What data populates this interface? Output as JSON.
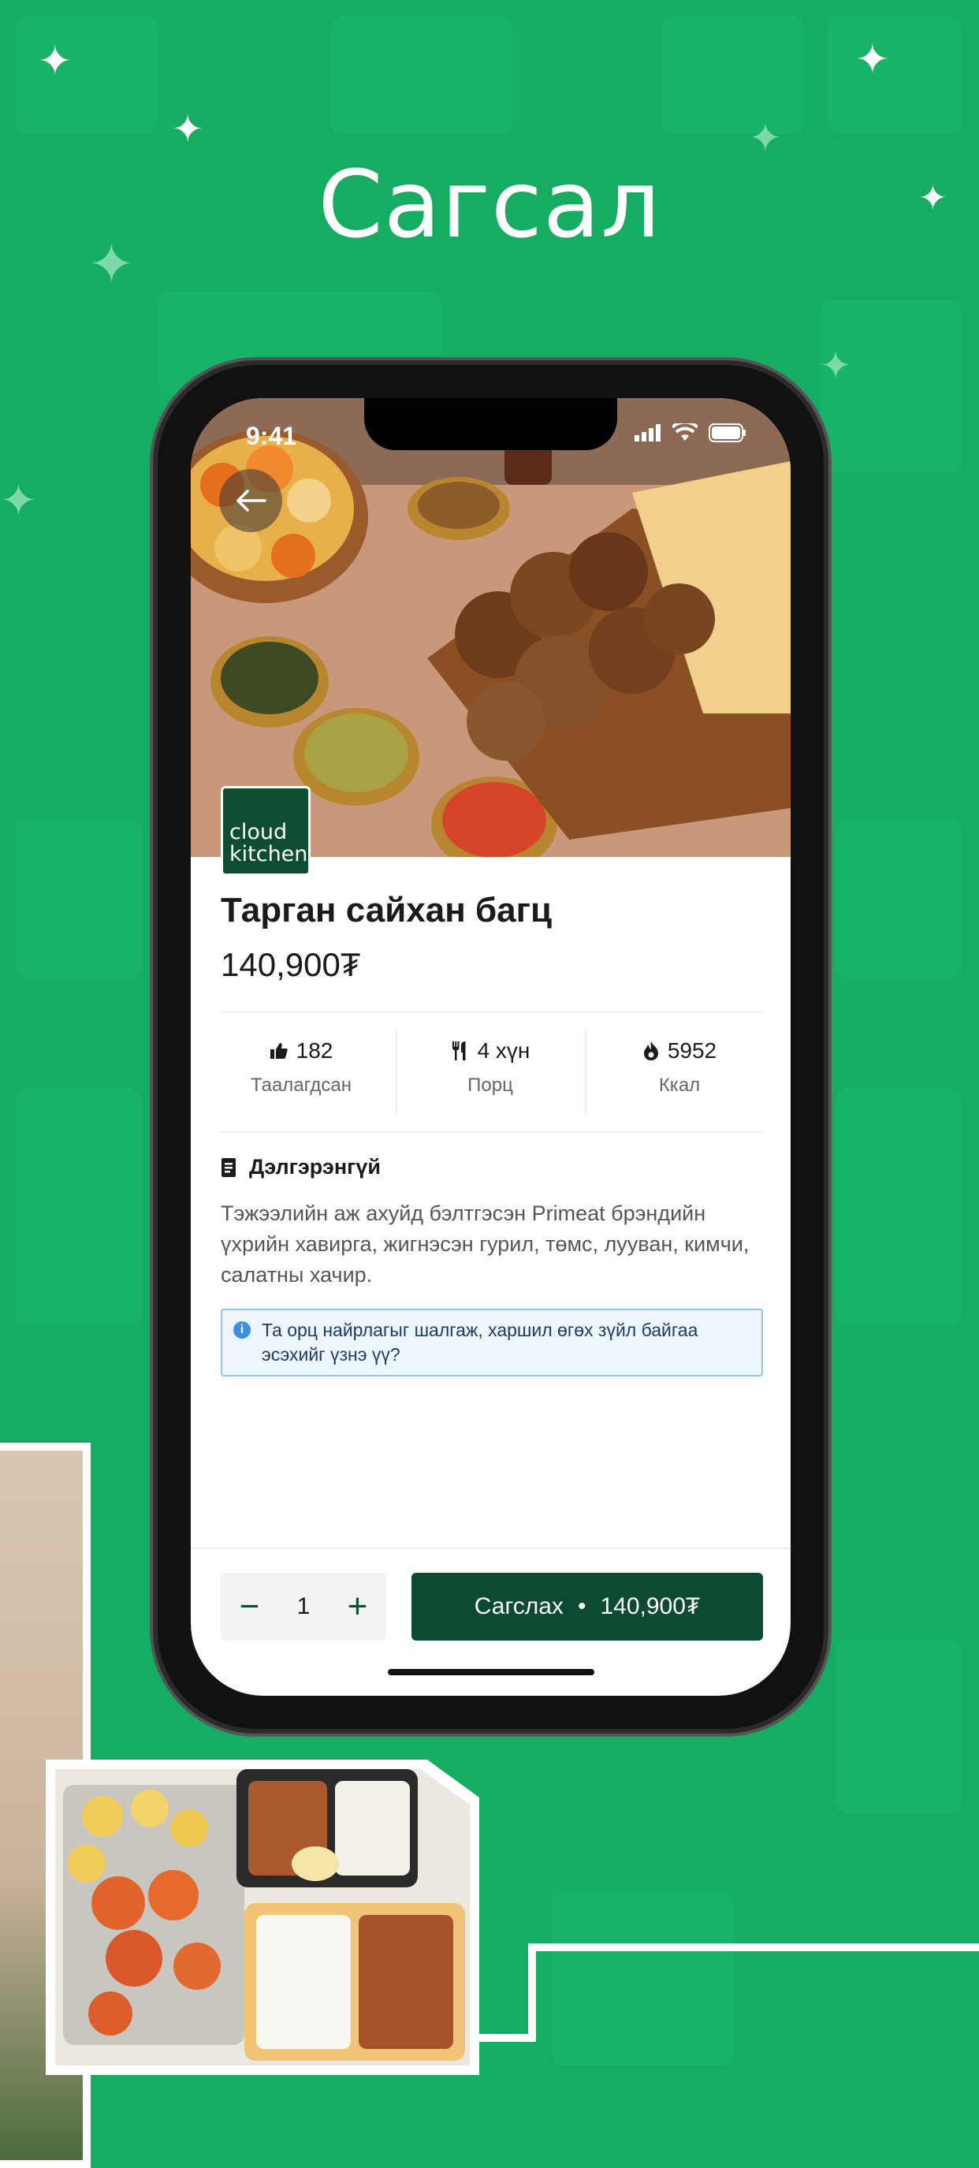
{
  "headline": "Сагсал",
  "status_bar": {
    "time": "9:41"
  },
  "brand": {
    "line1": "cloud",
    "line2": "kitchen"
  },
  "product": {
    "title": "Тарган сайхан багц",
    "price": "140,900₮"
  },
  "stats": [
    {
      "icon": "thumbs-up-icon",
      "value": "182",
      "label": "Таалагдсан"
    },
    {
      "icon": "fork-knife-icon",
      "value": "4 хүн",
      "label": "Порц"
    },
    {
      "icon": "flame-icon",
      "value": "5952",
      "label": "Ккал"
    }
  ],
  "details": {
    "heading": "Дэлгэрэнгүй",
    "description": "Тэжээлийн аж ахуйд бэлтгэсэн Primeat брэндийн үхрийн хавирга, жигнэсэн гурил, төмс, лууван, кимчи, салатны хачир.",
    "notice": "Та орц найрлагыг шалгаж, харшил өгөх зүйл байгаа эсэхийг үзнэ үү?"
  },
  "cart": {
    "quantity": "1",
    "button_label": "Сагслах",
    "separator": "•",
    "button_price": "140,900₮"
  },
  "colors": {
    "background": "#16ad62",
    "primary": "#0d4a32",
    "info_border": "#8ec6f2"
  }
}
